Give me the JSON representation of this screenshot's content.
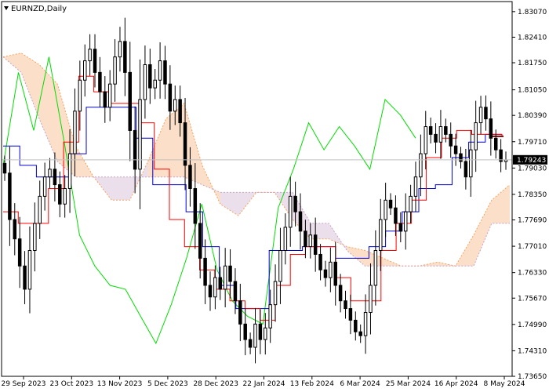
{
  "window": {
    "symbol_label": "EURNZD,Daily",
    "collapse_icon": "triangle-down-icon"
  },
  "colors": {
    "background": "#ffffff",
    "axis": "#000000",
    "candle": "#000000",
    "tenkan": "#ff0000",
    "kijun": "#0000cd",
    "chikou": "#00dd00",
    "cloud_a": "#f4a460",
    "cloud_b": "#c8a2c8",
    "price_line": "#c0c0c0",
    "price_badge": "#000000",
    "marker": "#800000"
  },
  "chart_data": {
    "type": "candlestick",
    "indicator": "Ichimoku Kinko Hyo",
    "ylim": [
      1.7365,
      1.8333
    ],
    "y_ticks": [
      "1.83070",
      "1.82410",
      "1.81750",
      "1.81050",
      "1.80390",
      "1.79710",
      "1.79030",
      "1.78350",
      "1.77690",
      "1.77010",
      "1.76330",
      "1.75670",
      "1.74990",
      "1.74310",
      "1.73650"
    ],
    "x_ticks": [
      "29 Sep 2023",
      "23 Oct 2023",
      "13 Nov 2023",
      "5 Dec 2023",
      "28 Dec 2023",
      "22 Jan 2024",
      "13 Feb 2024",
      "6 Mar 2024",
      "25 Mar 2024",
      "16 Apr 2024",
      "8 May 2024"
    ],
    "current_price": "1.79243",
    "tenkan_marker": 1.7985,
    "series": [
      {
        "role": "close",
        "values": [
          1.789,
          1.777,
          1.772,
          1.765,
          1.759,
          1.769,
          1.776,
          1.783,
          1.788,
          1.79,
          1.786,
          1.781,
          1.785,
          1.794,
          1.805,
          1.813,
          1.818,
          1.821,
          1.815,
          1.81,
          1.806,
          1.812,
          1.819,
          1.823,
          1.815,
          1.8,
          1.79,
          1.808,
          1.817,
          1.811,
          1.813,
          1.818,
          1.812,
          1.805,
          1.808,
          1.802,
          1.791,
          1.785,
          1.776,
          1.767,
          1.76,
          1.757,
          1.762,
          1.759,
          1.765,
          1.761,
          1.756,
          1.75,
          1.746,
          1.744,
          1.75,
          1.746,
          1.749,
          1.755,
          1.761,
          1.769,
          1.775,
          1.783,
          1.779,
          1.774,
          1.77,
          1.773,
          1.768,
          1.764,
          1.762,
          1.766,
          1.76,
          1.756,
          1.754,
          1.751,
          1.748,
          1.747,
          1.753,
          1.76,
          1.769,
          1.777,
          1.782,
          1.78,
          1.776,
          1.774,
          1.779,
          1.783,
          1.788,
          1.794,
          1.801,
          1.799,
          1.797,
          1.801,
          1.799,
          1.796,
          1.794,
          1.792,
          1.788,
          1.795,
          1.802,
          1.806,
          1.803,
          1.798,
          1.795,
          1.792,
          1.7924
        ]
      },
      {
        "role": "tenkan-sen",
        "values": [
          1.779,
          1.776,
          1.776,
          1.785,
          1.797,
          1.814,
          1.81,
          1.807,
          1.807,
          1.802,
          1.79,
          1.777,
          1.77,
          1.764,
          1.759,
          1.756,
          1.754,
          1.751,
          1.76,
          1.768,
          1.77,
          1.77,
          1.762,
          1.756,
          1.756,
          1.769,
          1.776,
          1.782,
          1.793,
          1.798,
          1.8,
          1.799,
          1.799,
          1.7985
        ]
      },
      {
        "role": "kijun-sen",
        "values": [
          1.796,
          1.791,
          1.788,
          1.788,
          1.794,
          1.806,
          1.806,
          1.806,
          1.798,
          1.786,
          1.786,
          1.779,
          1.77,
          1.76,
          1.754,
          1.754,
          1.769,
          1.769,
          1.77,
          1.77,
          1.767,
          1.767,
          1.77,
          1.774,
          1.779,
          1.785,
          1.786,
          1.793,
          1.797,
          1.799,
          1.799
        ]
      },
      {
        "role": "chikou-span",
        "values": [
          1.791,
          1.815,
          1.8,
          1.819,
          1.797,
          1.773,
          1.765,
          1.76,
          1.759,
          1.752,
          1.745,
          1.755,
          1.767,
          1.781,
          1.764,
          1.756,
          1.752,
          1.75,
          1.78,
          1.79,
          1.802,
          1.795,
          1.801,
          1.796,
          1.79,
          1.808,
          1.804,
          1.798
        ]
      },
      {
        "role": "senkou-span-a",
        "values": [
          1.819,
          1.82,
          1.817,
          1.812,
          1.796,
          1.788,
          1.782,
          1.782,
          1.792,
          1.803,
          1.807,
          1.791,
          1.781,
          1.778,
          1.784,
          1.784,
          1.777,
          1.772,
          1.772,
          1.77,
          1.769,
          1.767,
          1.765,
          1.765,
          1.766,
          1.765,
          1.773,
          1.782,
          1.786
        ]
      },
      {
        "role": "senkou-span-b",
        "values": [
          1.819,
          1.815,
          1.803,
          1.792,
          1.788,
          1.788,
          1.788,
          1.788,
          1.788,
          1.788,
          1.788,
          1.786,
          1.784,
          1.784,
          1.784,
          1.784,
          1.784,
          1.776,
          1.776,
          1.769,
          1.765,
          1.765,
          1.765,
          1.765,
          1.765,
          1.765,
          1.765,
          1.776,
          1.776
        ]
      }
    ]
  }
}
